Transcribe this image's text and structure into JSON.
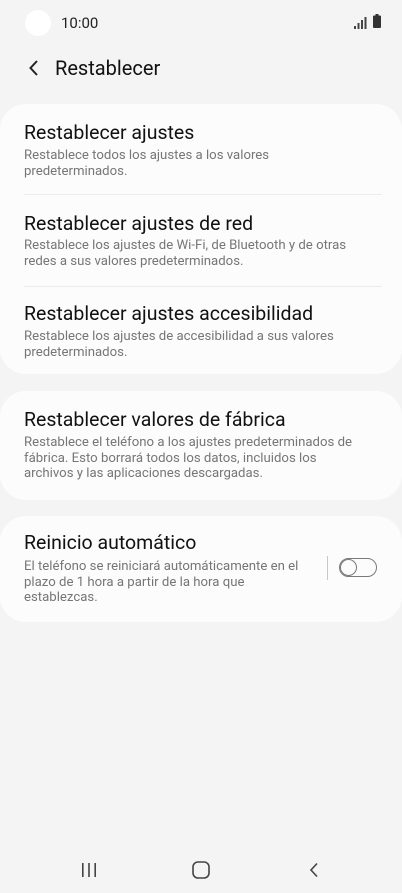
{
  "status_bar": {
    "time": "10:00",
    "signal_icon": "signal-icon",
    "battery_icon": "battery-icon"
  },
  "app_bar": {
    "back_icon": "chevron-left-icon",
    "title": "Restablecer"
  },
  "sections": [
    {
      "items": [
        {
          "title": "Restablecer ajustes",
          "description": "Restablece todos los ajustes a los valores predeterminados."
        },
        {
          "title": "Restablecer ajustes de red",
          "description": "Restablece los ajustes de Wi-Fi, de Bluetooth y de otras redes a sus valores predeterminados."
        },
        {
          "title": "Restablecer ajustes accesibilidad",
          "description": "Restablece los ajustes de accesibilidad a sus valores predeterminados."
        }
      ]
    },
    {
      "items": [
        {
          "title": "Restablecer valores de fábrica",
          "description": "Restablece el teléfono a los ajustes predeterminados de fábrica. Esto borrará todos los datos, incluidos los archivos y las aplicaciones descargadas."
        }
      ]
    },
    {
      "items": [
        {
          "title": "Reinicio automático",
          "description": "El teléfono se reiniciará automáticamente en el plazo de 1 hora a partir de la hora que establezcas.",
          "toggle_on": false
        }
      ]
    }
  ],
  "nav_bar": {
    "recents_icon": "recents-icon",
    "home_icon": "home-icon",
    "back_icon": "back-icon"
  },
  "colors": {
    "background": "#f4f4f4",
    "card": "#fcfcfc",
    "secondary_text": "#767676"
  }
}
